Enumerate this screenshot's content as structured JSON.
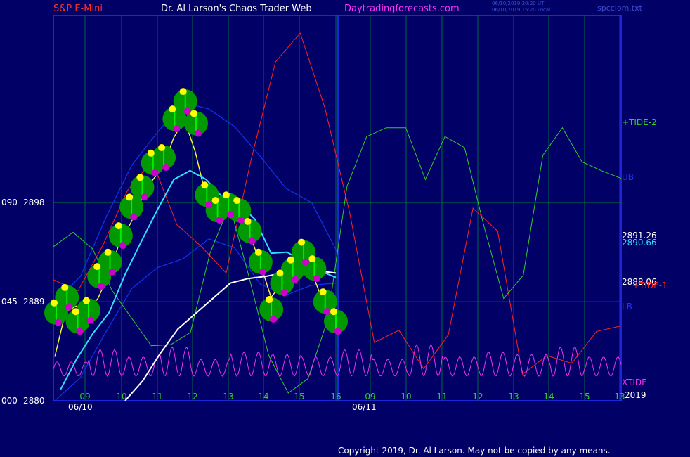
{
  "header": {
    "symbol": "S&P E-Mini",
    "title": "Dr. Al Larson's Chaos Trader Web",
    "site": "Daytradingforecasts.com",
    "timestamp_utc": "06/10/2019 20:20 UT",
    "timestamp_local": "06/10/2019 15:20 Local",
    "file": "spcclom.txt"
  },
  "copyright": "Copyright 2019, Dr. Al Larson. May not be copied by any means.",
  "colors": {
    "background": "#000066",
    "frame": "#2233ff",
    "grid": "#006644",
    "price_bars": "#00ee00",
    "ma_yellow": "#ffff33",
    "ma_cyan": "#33ddff",
    "ma_white": "#ffffff",
    "band_blue": "#1133ee",
    "tide_green": "#33cc33",
    "tide_red": "#ff2222",
    "xtide_magenta": "#ee33ee",
    "dot_high": "#ffff00",
    "dot_low": "#cc00cc",
    "halo": "#009900"
  },
  "chart_data": {
    "type": "line",
    "title": "S&P E-Mini",
    "y_ticks": [
      {
        "left": "090",
        "price": "2898",
        "value": 2898
      },
      {
        "left": "045",
        "price": "2889",
        "value": 2889
      },
      {
        "left": "000",
        "price": "2880",
        "value": 2880
      }
    ],
    "ylim": [
      2880,
      2915
    ],
    "x_ticks_day1": [
      "09",
      "10",
      "11",
      "12",
      "13",
      "14",
      "15",
      "16"
    ],
    "x_ticks_day2": [
      "09",
      "10",
      "11",
      "12",
      "13",
      "14",
      "15",
      "13"
    ],
    "dates": [
      "06/10",
      "06/11"
    ],
    "year": "2019",
    "right_labels": [
      {
        "text": "+TIDE-2",
        "color": "#33cc33"
      },
      {
        "text": "UB",
        "color": "#2233ff"
      },
      {
        "text": "2891.26",
        "color": "#ffffff"
      },
      {
        "text": "2890.66",
        "color": "#33ddff"
      },
      {
        "text": "2888.06",
        "color": "#ffffff"
      },
      {
        "text": "+TIDE-1",
        "color": "#ff2222"
      },
      {
        "text": "LB",
        "color": "#2233ff"
      },
      {
        "text": "XTIDE",
        "color": "#ee33ee"
      }
    ],
    "last_values": {
      "white_ma": 2891.26,
      "cyan_ma": 2890.66,
      "close": 2888.06
    },
    "price_close_path": [
      2888,
      2889.4,
      2887.2,
      2888.2,
      2891.3,
      2892.6,
      2895,
      2897.6,
      2899.4,
      2901.6,
      2902.1,
      2905.6,
      2907.2,
      2905.2,
      2898.7,
      2897.3,
      2897.8,
      2897.3,
      2895.4,
      2892.6,
      2888.3,
      2890.7,
      2891.9,
      2893.5,
      2892,
      2889,
      2887.2
    ],
    "yellow_ma_path": [
      2884,
      2888.1,
      2888.6,
      2888.2,
      2889.3,
      2891.5,
      2894.4,
      2896.1,
      2898.2,
      2900,
      2901.2,
      2903.9,
      2905.5,
      2902.6,
      2898.5,
      2897.3,
      2897.8,
      2896.9,
      2895.2,
      2892.5,
      2889.4,
      2890.6,
      2891.8,
      2892.6,
      2891.1,
      2888.5,
      2887.5
    ],
    "cyan_ma_path": [
      2881,
      2883.8,
      2886.1,
      2888,
      2891.5,
      2894.5,
      2897.4,
      2900.1,
      2900.9,
      2900.1,
      2898.5,
      2897.9,
      2896.5,
      2893.4,
      2893.5,
      2892.6,
      2891.8,
      2891.2
    ],
    "white_ma_path": [
      2880,
      2881.8,
      2884.3,
      2886.5,
      2887.9,
      2889.3,
      2890.7,
      2891.1,
      2891.3,
      2891.6,
      2891.9,
      2891.8,
      2891.6
    ],
    "upper_band_path": [
      2889,
      2891.3,
      2896.7,
      2901.4,
      2904.4,
      2907.1,
      2906.5,
      2904.9,
      2902.2,
      2899.3,
      2898,
      2893.5
    ],
    "lower_band_path": [
      2880,
      2882.1,
      2886.3,
      2890.2,
      2892.1,
      2892.9,
      2894.7,
      2893.9,
      2890.6,
      2889.6,
      2890.5,
      2890.7
    ],
    "tide_green_path": [
      2894,
      2895.3,
      2893.8,
      2890,
      2887.5,
      2885,
      2885.1,
      2886.2,
      2893.4,
      2897.8,
      2891.2,
      2884.1,
      2880.7,
      2882,
      2887.3,
      2899.5,
      2904,
      2904.8,
      2904.8,
      2900.1,
      2904,
      2903,
      2895.8,
      2889.3,
      2891.4,
      2902.3,
      2904.8,
      2901.7,
      2900.9,
      2900.2
    ],
    "tide_red_path": [
      2891,
      2890,
      2894.1,
      2899.1,
      2901.8,
      2896,
      2894,
      2891.6,
      2901.8,
      2910.8,
      2913.4,
      2906.6,
      2897.1,
      2885.3,
      2886.4,
      2882.9,
      2886,
      2897.5,
      2895.4,
      2882.4,
      2884.1,
      2883.4,
      2886.3,
      2886.8
    ],
    "xtide_peaks": [
      0.3,
      0.8,
      0.5,
      0.9,
      0.4,
      0.7,
      0.6,
      0.5,
      0.8,
      0.4,
      1.0,
      0.5,
      0.7,
      0.6,
      0.9,
      0.5
    ]
  }
}
